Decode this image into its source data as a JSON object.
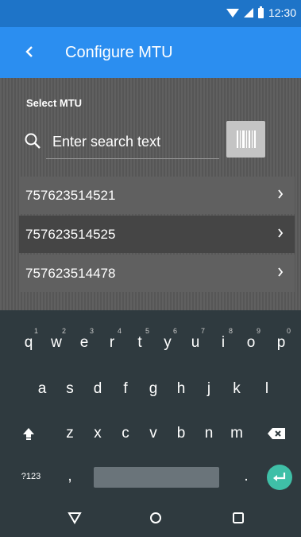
{
  "status_bar": {
    "time": "12:30",
    "icons": [
      "wifi-icon",
      "signal-icon",
      "battery-icon"
    ]
  },
  "app_bar": {
    "title": "Configure MTU",
    "back_icon": "chevron-left-icon"
  },
  "main": {
    "section_label": "Select MTU",
    "search": {
      "placeholder": "Enter search text",
      "value": ""
    },
    "barcode_icon": "barcode-icon",
    "mtu_list": [
      {
        "id": "757623514521",
        "selected": false
      },
      {
        "id": "757623514525",
        "selected": true
      },
      {
        "id": "757623514478",
        "selected": false
      }
    ]
  },
  "keyboard": {
    "row1": [
      {
        "key": "q",
        "hint": "1"
      },
      {
        "key": "w",
        "hint": "2"
      },
      {
        "key": "e",
        "hint": "3"
      },
      {
        "key": "r",
        "hint": "4"
      },
      {
        "key": "t",
        "hint": "5"
      },
      {
        "key": "y",
        "hint": "6"
      },
      {
        "key": "u",
        "hint": "7"
      },
      {
        "key": "i",
        "hint": "8"
      },
      {
        "key": "o",
        "hint": "9"
      },
      {
        "key": "p",
        "hint": "0"
      }
    ],
    "row2": [
      "a",
      "s",
      "d",
      "f",
      "g",
      "h",
      "j",
      "k",
      "l"
    ],
    "row3": [
      "z",
      "x",
      "c",
      "v",
      "b",
      "n",
      "m"
    ],
    "row4": {
      "symbols": "?123",
      "comma": ",",
      "period": "."
    }
  },
  "nav_bar": {
    "icons": [
      "back-triangle-icon",
      "home-circle-icon",
      "recents-square-icon"
    ]
  },
  "colors": {
    "status_bar": "#1e74c8",
    "app_bar": "#2b8ef0",
    "content_bg": "#5a5a5a",
    "selected_row": "#454545",
    "keyboard_bg": "#2f3a3f",
    "enter_key": "#3fbfa7"
  }
}
